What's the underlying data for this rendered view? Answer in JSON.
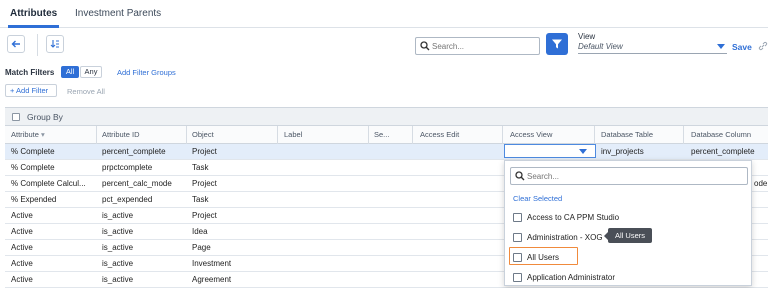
{
  "tabs": [
    {
      "label": "Attributes"
    },
    {
      "label": "Investment Parents"
    }
  ],
  "toolbar": {
    "search_placeholder": "Search...",
    "view_label": "View",
    "view_value": "Default View",
    "save_label": "Save"
  },
  "filters": {
    "match_label": "Match Filters",
    "all_label": "All",
    "any_label": "Any",
    "add_groups_label": "Add Filter Groups",
    "add_filter_label": "+ Add Filter",
    "remove_all_label": "Remove All"
  },
  "grid": {
    "group_by_label": "Group By",
    "columns": [
      "Attribute",
      "Attribute ID",
      "Object",
      "Label",
      "Se...",
      "Access Edit",
      "Access View",
      "Database Table",
      "Database Column"
    ],
    "rows": [
      {
        "attribute": "% Complete",
        "attribute_id": "percent_complete",
        "object": "Project",
        "db_table": "inv_projects",
        "db_column": "percent_complete"
      },
      {
        "attribute": "% Complete",
        "attribute_id": "prpctcomplete",
        "object": "Task"
      },
      {
        "attribute": "% Complete Calcul...",
        "attribute_id": "percent_calc_mode",
        "object": "Project",
        "db_column": "ode"
      },
      {
        "attribute": "% Expended",
        "attribute_id": "pct_expended",
        "object": "Task"
      },
      {
        "attribute": "Active",
        "attribute_id": "is_active",
        "object": "Project"
      },
      {
        "attribute": "Active",
        "attribute_id": "is_active",
        "object": "Idea"
      },
      {
        "attribute": "Active",
        "attribute_id": "is_active",
        "object": "Page"
      },
      {
        "attribute": "Active",
        "attribute_id": "is_active",
        "object": "Investment"
      },
      {
        "attribute": "Active",
        "attribute_id": "is_active",
        "object": "Agreement"
      }
    ]
  },
  "dropdown": {
    "search_placeholder": "Search...",
    "clear_selected": "Clear Selected",
    "options": [
      "Access to CA PPM Studio",
      "Administration - XOG",
      "All Users",
      "Application Administrator"
    ],
    "tooltip": "All Users"
  },
  "colors": {
    "accent": "#2f6fd6",
    "highlight": "#f08a3c",
    "selected_row": "#e3edfa"
  }
}
